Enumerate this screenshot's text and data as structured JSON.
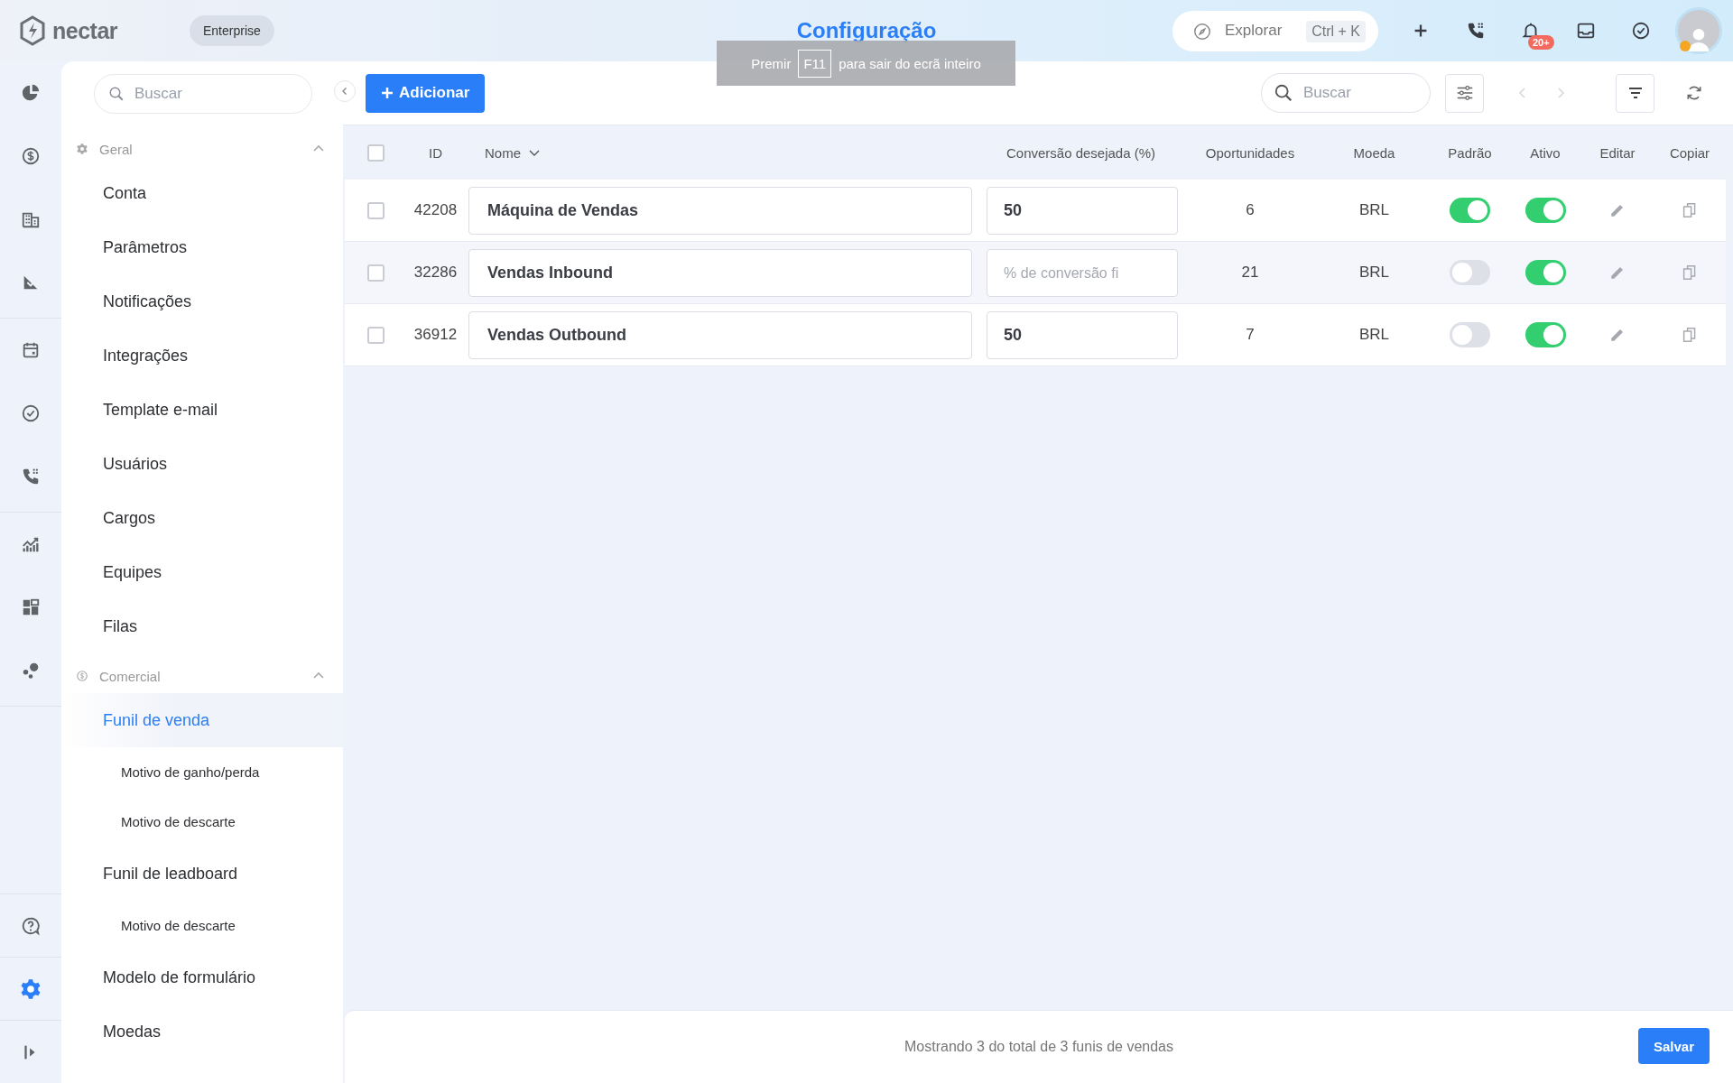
{
  "topbar": {
    "brand": "nectar",
    "plan": "Enterprise",
    "title": "Configuração",
    "explore": {
      "placeholder": "Explorar",
      "shortcut": "Ctrl + K"
    },
    "actions": [
      {
        "kind": "plus"
      },
      {
        "kind": "phone"
      },
      {
        "kind": "bell",
        "badge": "20+"
      },
      {
        "kind": "inbox"
      },
      {
        "kind": "check"
      }
    ]
  },
  "fullscreen_notice": {
    "before": "Premir",
    "key": "F11",
    "after": "para sair do ecrã inteiro"
  },
  "rail": {
    "top": [
      [
        {
          "kind": "pie",
          "selected": false
        },
        {
          "kind": "dollar",
          "selected": false
        },
        {
          "kind": "building",
          "selected": false
        },
        {
          "kind": "chart-down",
          "selected": false
        }
      ],
      [
        {
          "kind": "calendar",
          "selected": false
        },
        {
          "kind": "check",
          "selected": false
        },
        {
          "kind": "phone",
          "selected": false
        }
      ],
      [
        {
          "kind": "chart-up",
          "selected": false
        },
        {
          "kind": "widgets",
          "selected": false
        },
        {
          "kind": "bubbles",
          "selected": false
        }
      ]
    ],
    "bottom": [
      {
        "kind": "help",
        "selected": false
      },
      {
        "kind": "settings",
        "selected": true
      },
      {
        "kind": "expand",
        "selected": false
      }
    ]
  },
  "sidebar": {
    "search": {
      "placeholder": "Buscar"
    },
    "sections": [
      {
        "label": "Geral",
        "kind": "gear",
        "expanded": true,
        "children": [
          {
            "label": "Conta",
            "selected": false
          },
          {
            "label": "Parâmetros",
            "selected": false
          },
          {
            "label": "Notificações",
            "selected": false
          },
          {
            "label": "Integrações",
            "selected": false
          },
          {
            "label": "Template e-mail",
            "selected": false
          },
          {
            "label": "Usuários",
            "selected": false
          },
          {
            "label": "Cargos",
            "selected": false
          },
          {
            "label": "Equipes",
            "selected": false
          },
          {
            "label": "Filas",
            "selected": false
          }
        ]
      },
      {
        "label": "Comercial",
        "kind": "dollar",
        "expanded": true,
        "children": [
          {
            "label": "Funil de venda",
            "selected": true,
            "children": [
              {
                "label": "Motivo de ganho/perda",
                "selected": false
              },
              {
                "label": "Motivo de descarte",
                "selected": false
              }
            ]
          },
          {
            "label": "Funil de leadboard",
            "selected": false,
            "children": [
              {
                "label": "Motivo de descarte",
                "selected": false
              }
            ]
          },
          {
            "label": "Modelo de formulário",
            "selected": false
          },
          {
            "label": "Moedas",
            "selected": false
          }
        ]
      }
    ]
  },
  "toolbar": {
    "add_button": "Adicionar",
    "search": {
      "placeholder": "Buscar"
    },
    "prev_disabled": true,
    "next_disabled": true
  },
  "table": {
    "all_checked": false,
    "columns": [
      "ID",
      "Nome",
      "Conversão desejada (%)",
      "Oportunidades",
      "Moeda",
      "Padrão",
      "Ativo",
      "Editar",
      "Copiar"
    ],
    "rows": [
      {
        "checked": false,
        "id": "42208",
        "name": "Máquina de Vendas",
        "conversion": "50",
        "opportunities": "6",
        "currency": "BRL",
        "default": true,
        "active": true
      },
      {
        "checked": false,
        "id": "32286",
        "name": "Vendas Inbound",
        "conversion_placeholder": "% de conversão fi",
        "opportunities": "21",
        "currency": "BRL",
        "default": false,
        "active": true
      },
      {
        "checked": false,
        "id": "36912",
        "name": "Vendas Outbound",
        "conversion": "50",
        "opportunities": "7",
        "currency": "BRL",
        "default": false,
        "active": true
      }
    ]
  },
  "footer": {
    "summary": "Mostrando 3 do total de 3 funis de vendas",
    "save_button": "Salvar"
  }
}
